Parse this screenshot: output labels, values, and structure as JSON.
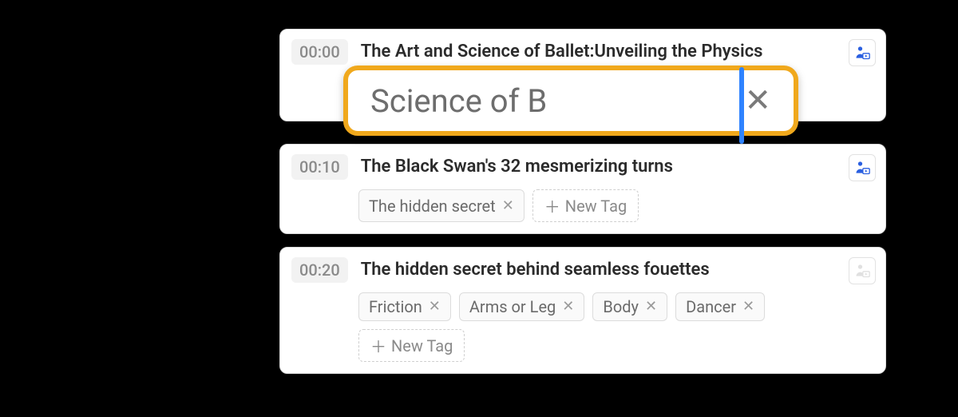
{
  "segments": [
    {
      "time": "00:00",
      "title": "The Art and Science of Ballet:Unveiling the Physics",
      "tags": [],
      "iconActive": true
    },
    {
      "time": "00:10",
      "title": "The Black Swan's 32 mesmerizing turns",
      "tags": [
        "The hidden secret"
      ],
      "iconActive": true
    },
    {
      "time": "00:20",
      "title": "The hidden secret behind seamless fouettes",
      "tags": [
        "Friction",
        "Arms or Leg",
        "Body",
        "Dancer"
      ],
      "iconActive": false
    }
  ],
  "newTagLabel": "New Tag",
  "editInput": {
    "value": "Science of B"
  }
}
